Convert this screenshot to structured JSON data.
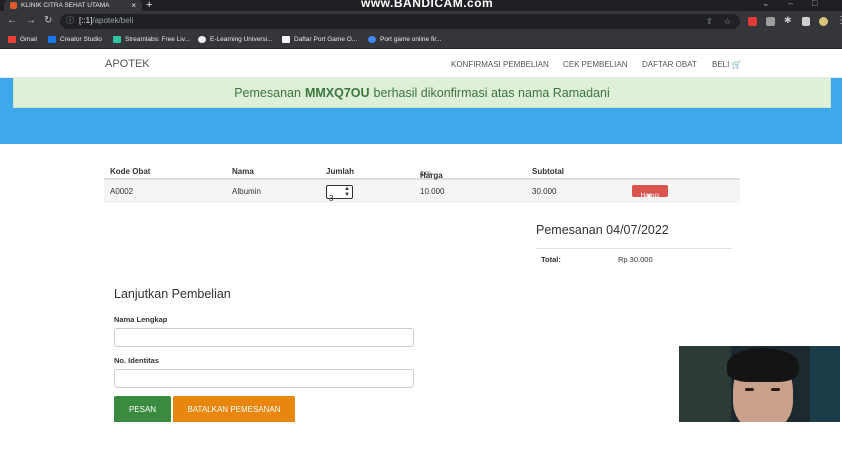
{
  "browser": {
    "tab_title": "KLINIK CITRA SEHAT UTAMA",
    "tab_close": "×",
    "new_tab": "+",
    "recorder_banner": "www.BANDICAM.com",
    "url_host": "[::1]",
    "url_path": "/apotek/beli",
    "bookmarks": [
      {
        "label": "Gmail",
        "color": "#ea4335"
      },
      {
        "label": "Creator Studio",
        "color": "#1877f2"
      },
      {
        "label": "Streamlabs: Free Liv...",
        "color": "#31c3a2"
      },
      {
        "label": "E-Learning Universi...",
        "color": "#f2f2f2"
      },
      {
        "label": "Daftar Port Game O...",
        "color": "#f4f4f4"
      },
      {
        "label": "Port game online fir...",
        "color": "#4285f4"
      }
    ]
  },
  "navbar": {
    "brand": "APOTEK",
    "links": [
      "KONFIRMASI PEMBELIAN",
      "CEK PEMBELIAN",
      "DAFTAR OBAT",
      "BELI"
    ]
  },
  "alert": {
    "prefix": "Pemesanan",
    "code": "MMXQ7OU",
    "suffix": "berhasil dikonfirmasi atas nama Ramadani",
    "color": "#3c763d"
  },
  "table": {
    "headers": {
      "kode": "Kode Obat",
      "nama": "Nama",
      "jumlah": "Jumlah",
      "harga": "Harga",
      "harga_unit": "/pcs",
      "subtotal": "Subtotal"
    },
    "rows": [
      {
        "kode": "A0002",
        "nama": "Albumin",
        "jumlah": "3",
        "harga": "10.000",
        "subtotal": "30.000",
        "hapus": "Hapus"
      }
    ]
  },
  "summary": {
    "title": "Pemesanan 04/07/2022",
    "total_label": "Total:",
    "total_value": "Rp 30.000"
  },
  "form": {
    "title": "Lanjutkan Pembelian",
    "nama_label": "Nama Lengkap",
    "nama_value": "",
    "identitas_label": "No. Identitas",
    "identitas_value": "",
    "pesan": "PESAN",
    "batal": "BATALKAN PEMESANAN"
  },
  "colors": {
    "banner": "#3ea8ec",
    "pesan_button": "#3a8a3f",
    "batal_button": "#e8860d",
    "hapus_button": "#d9534f"
  }
}
